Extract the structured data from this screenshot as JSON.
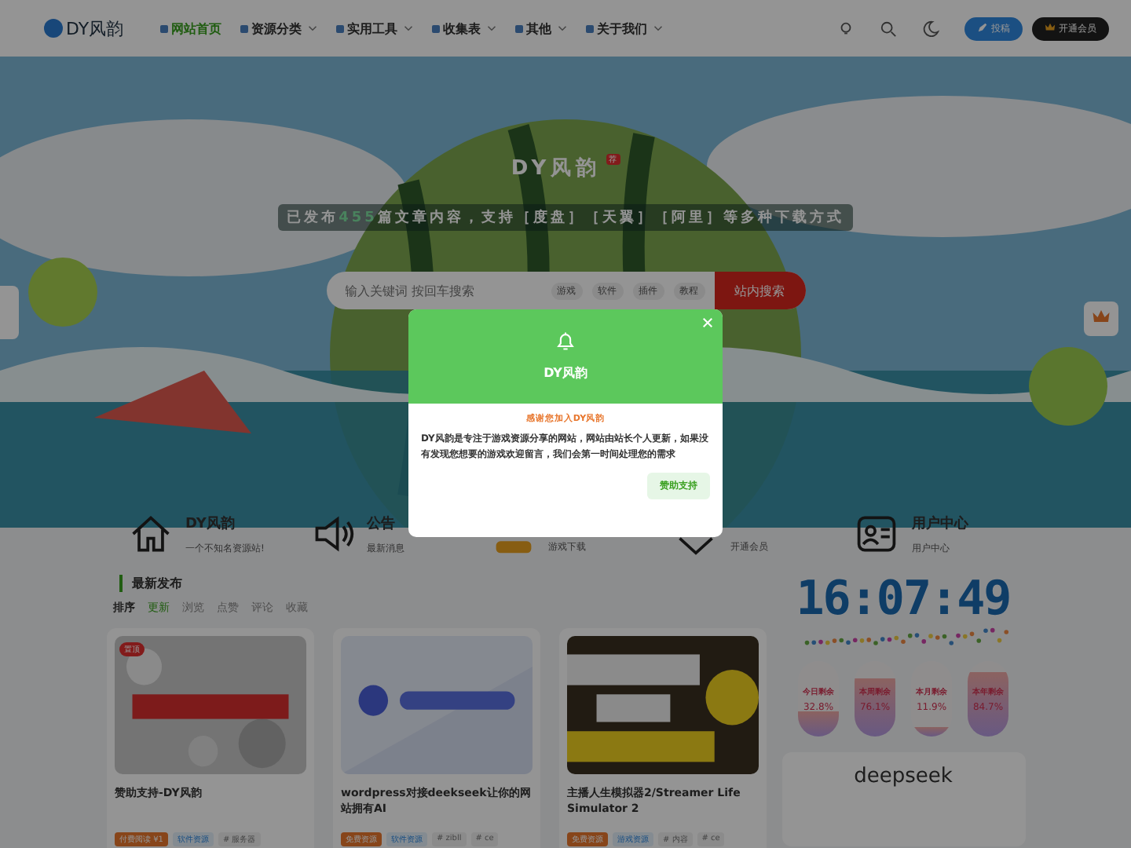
{
  "header": {
    "logo": "DY风韵",
    "nav": [
      {
        "label": "网站首页",
        "selected": true,
        "dropdown": false
      },
      {
        "label": "资源分类",
        "selected": false,
        "dropdown": true
      },
      {
        "label": "实用工具",
        "selected": false,
        "dropdown": true
      },
      {
        "label": "收集表",
        "selected": false,
        "dropdown": true
      },
      {
        "label": "其他",
        "selected": false,
        "dropdown": true
      },
      {
        "label": "关于我们",
        "selected": false,
        "dropdown": true
      }
    ],
    "post_button": "投稿",
    "vip_button": "开通会员"
  },
  "hero": {
    "title": "DY风韵",
    "badge": "荐",
    "stats_before": "已发布",
    "stats_count": "455",
    "stats_after": "篇文章内容，支持［度盘］［天翼］［阿里］等多种下载方式",
    "search": {
      "placeholder": "输入关键词 按回车搜索",
      "tags": [
        "游戏",
        "软件",
        "插件",
        "教程"
      ],
      "button": "站内搜索"
    }
  },
  "features": [
    {
      "title": "DY风韵",
      "subtitle": "一个不知名资源站!"
    },
    {
      "title": "公告",
      "subtitle": "最新消息"
    },
    {
      "subtitle": "游戏下载"
    },
    {
      "subtitle": "开通会员"
    },
    {
      "title": "用户中心",
      "subtitle": "用户中心"
    }
  ],
  "latest": {
    "heading": "最新发布",
    "sort_label": "排序",
    "sorts": [
      {
        "label": "更新",
        "selected": true
      },
      {
        "label": "浏览",
        "selected": false
      },
      {
        "label": "点赞",
        "selected": false
      },
      {
        "label": "评论",
        "selected": false
      },
      {
        "label": "收藏",
        "selected": false
      }
    ],
    "posts": [
      {
        "badge": "置顶",
        "title": "赞助支持-DY风韵",
        "tags": [
          {
            "kind": "price",
            "label": "付费阅读 ¥1"
          },
          {
            "kind": "category",
            "label": "软件资源"
          },
          {
            "kind": "tag",
            "label": "# 服务器"
          }
        ]
      },
      {
        "title": "wordpress对接deekseek让你的网站拥有AI",
        "tags": [
          {
            "kind": "price",
            "label": "免费资源"
          },
          {
            "kind": "category",
            "label": "软件资源"
          },
          {
            "kind": "tag",
            "label": "# zibll"
          },
          {
            "kind": "tag",
            "label": "# ce"
          }
        ]
      },
      {
        "title": "主播人生模拟器2/Streamer Life Simulator 2",
        "tags": [
          {
            "kind": "price",
            "label": "免费资源"
          },
          {
            "kind": "category",
            "label": "游戏资源"
          },
          {
            "kind": "tag",
            "label": "# 内容"
          },
          {
            "kind": "tag",
            "label": "# ce"
          }
        ]
      }
    ]
  },
  "sidebar": {
    "clock": "16:07:49",
    "progress": [
      {
        "label": "今日剩余",
        "reading": "32.8%",
        "level": 0.328
      },
      {
        "label": "本周剩余",
        "reading": "76.1%",
        "level": 0.761
      },
      {
        "label": "本月剩余",
        "reading": "11.9%",
        "level": 0.119
      },
      {
        "label": "本年剩余",
        "reading": "84.7%",
        "level": 0.847
      }
    ],
    "widget_title": "deepseek"
  },
  "modal": {
    "title": "DY风韵",
    "subtitle": "感谢您加入DY风韵",
    "body": "DY风韵是专注于游戏资源分享的网站，网站由站长个人更新，如果没有发现您想要的游戏欢迎留言，我们会第一时间处理您的需求",
    "button": "赞助支持"
  }
}
